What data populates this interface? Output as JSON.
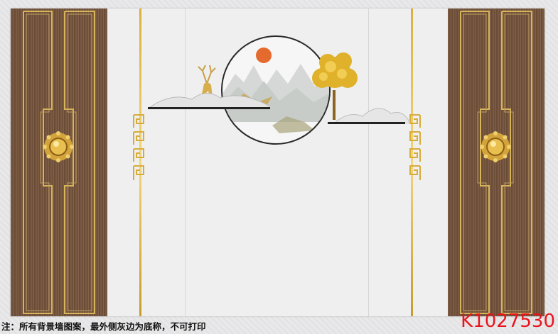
{
  "footer": {
    "note": "注：所有背景墙图案，最外侧灰边为底称，不可打印",
    "code": "K1027530"
  },
  "colors": {
    "wood": "#6f503a",
    "gold": "#d9b13b",
    "wall": "#efeff0",
    "code_red": "#e8141c"
  },
  "icons": {
    "left_knob": "gold-sunburst-knob-icon",
    "right_knob": "gold-sunburst-knob-icon",
    "sun": "red-sun-icon",
    "tree": "golden-tree-icon",
    "deer": "golden-deer-icon"
  }
}
